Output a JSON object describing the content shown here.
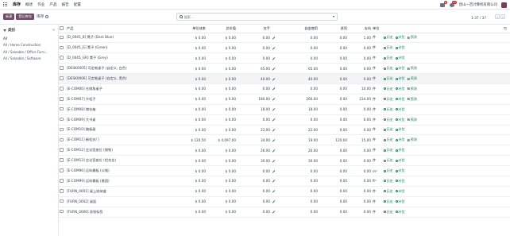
{
  "navbar": {
    "app_name": "库存",
    "menus": [
      "概述",
      "作业",
      "产品",
      "报告",
      "配置"
    ],
    "chat_count": "8",
    "activity_count": "13",
    "company": "昆山一百计算机有限公司"
  },
  "control": {
    "new_label": "新建",
    "secondary_label": "登记库存",
    "breadcrumb": "库存",
    "search_placeholder": "搜索...",
    "pager": "1-37 / 37"
  },
  "sidebar": {
    "title": "类别",
    "items": [
      "All",
      "All / Home Construction",
      "All / Saleable / Office Furni...",
      "All / Saleable / Software"
    ]
  },
  "table": {
    "headers": [
      "产品",
      "单位成本",
      "总价值",
      "在手",
      "自由使用",
      "进项",
      "去向",
      "单位"
    ],
    "actions": {
      "history": "历史",
      "replenish": "补货",
      "forecast": "预测"
    },
    "rows": [
      {
        "product": "[D_0045_B] 凳子 (Dark Blue)",
        "cost": "$ 0.00",
        "total": "$ 0.00",
        "onhand": "0.00",
        "free": "0.00",
        "in": "0.00",
        "out": "1.00",
        "uom": "件",
        "forecast": true
      },
      {
        "product": "[D_0045_G] 凳子 (Green)",
        "cost": "$ 0.00",
        "total": "$ 0.00",
        "onhand": "0.00",
        "free": "0.00",
        "in": "0.00",
        "out": "0.00",
        "uom": "件",
        "forecast": false
      },
      {
        "product": "[D_0045_GR] 凳子 (Grey)",
        "cost": "$ 0.00",
        "total": "$ 0.00",
        "onhand": "0.00",
        "free": "0.00",
        "in": "0.00",
        "out": "0.00",
        "uom": "件",
        "forecast": false
      },
      {
        "product": "[DESK0005] 可定制桌子 (自定义, 白色)",
        "cost": "$ 0.00",
        "total": "$ 0.00",
        "onhand": "65.00",
        "free": "65.00",
        "in": "0.00",
        "out": "0.00",
        "uom": "件",
        "forecast": true
      },
      {
        "product": "[DESK0006] 可定制桌子 (自定义, 黑色)",
        "cost": "$ 0.00",
        "total": "$ 0.00",
        "onhand": "40.00",
        "free": "40.00",
        "in": "0.00",
        "out": "0.00",
        "uom": "件",
        "forecast": true
      },
      {
        "product": "[E-COM06] 仓储角桌子",
        "cost": "$ 0.00",
        "total": "$ 0.00",
        "onhand": "0.00",
        "free": "0.00",
        "in": "0.00",
        "out": "10.00",
        "uom": "件",
        "forecast": true
      },
      {
        "product": "[E-COM07] 大柜子",
        "cost": "$ 0.00",
        "total": "$ 0.00",
        "onhand": "180.00",
        "free": "266.00",
        "in": "0.00",
        "out": "234.00",
        "uom": "件",
        "forecast": true
      },
      {
        "product": "[E-COM08] 储存箱",
        "cost": "$ 0.00",
        "total": "$ 0.00",
        "onhand": "18.00",
        "free": "18.00",
        "in": "0.00",
        "out": "0.00",
        "uom": "件",
        "forecast": false
      },
      {
        "product": "[E-COM09] 大书桌",
        "cost": "$ 0.00",
        "total": "$ 0.00",
        "onhand": "0.00",
        "free": "0.00",
        "in": "0.00",
        "out": "6.00",
        "uom": "件",
        "forecast": true
      },
      {
        "product": "[E-COM10] 踏板器",
        "cost": "$ 0.00",
        "total": "$ 0.00",
        "onhand": "22.00",
        "free": "22.00",
        "in": "0.00",
        "out": "0.00",
        "uom": "件",
        "forecast": false
      },
      {
        "product": "[E-COM11] 橱柜衣门",
        "cost": "$ 120.50",
        "total": "$ 4,097.00",
        "onhand": "34.00",
        "free": "19.00",
        "in": "120.00",
        "out": "15.00",
        "uom": "件",
        "forecast": true
      },
      {
        "product": "[E-COM12] 会议室座位 (钢铁)",
        "cost": "$ 0.00",
        "total": "$ 0.00",
        "onhand": "26.00",
        "free": "26.00",
        "in": "0.00",
        "out": "0.00",
        "uom": "件",
        "forecast": false
      },
      {
        "product": "[E-COM13] 会议室座位 (铝合金)",
        "cost": "$ 0.00",
        "total": "$ 0.00",
        "onhand": "30.00",
        "free": "30.00",
        "in": "0.00",
        "out": "0.00",
        "uom": "件",
        "forecast": false
      },
      {
        "product": "[E-COM96] 运料桶板 (公制)",
        "cost": "$ 0.00",
        "total": "$ 0.00",
        "onhand": "0.00",
        "free": "0.00",
        "in": "0.00",
        "out": "0.00",
        "uom": "m³",
        "forecast": false
      },
      {
        "product": "[E-COM99] 运料桶板 (美国)",
        "cost": "$ 0.00",
        "total": "$ 0.00",
        "onhand": "0.00",
        "free": "0.00",
        "in": "0.00",
        "out": "0.00",
        "uom": "ft³",
        "forecast": false
      },
      {
        "product": "[FURN_0001] 桌上收纳盒",
        "cost": "$ 0.00",
        "total": "$ 0.00",
        "onhand": "0.00",
        "free": "0.00",
        "in": "0.00",
        "out": "0.00",
        "uom": "件",
        "forecast": false
      },
      {
        "product": "[FURN_0002] 桌面",
        "cost": "$ 0.00",
        "total": "$ 0.00",
        "onhand": "0.00",
        "free": "0.00",
        "in": "0.00",
        "out": "0.00",
        "uom": "件",
        "forecast": false
      },
      {
        "product": "[FURN_0006] 尿袋标签",
        "cost": "$ 0.00",
        "total": "$ 0.00",
        "onhand": "0.00",
        "free": "0.00",
        "in": "0.00",
        "out": "0.00",
        "uom": "件",
        "forecast": false
      }
    ]
  },
  "colors": {
    "brand": "#714b67",
    "action": "#1f7a5b"
  }
}
